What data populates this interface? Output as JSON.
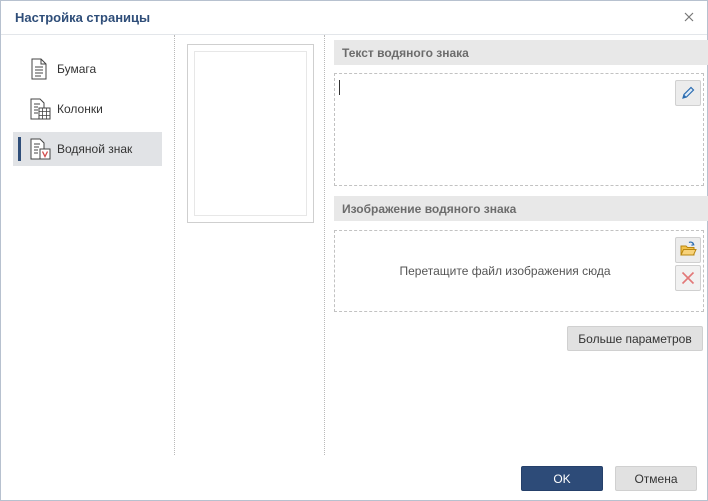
{
  "dialog": {
    "title": "Настройка страницы"
  },
  "nav": {
    "items": [
      {
        "label": "Бумага",
        "icon": "paper-icon",
        "active": false
      },
      {
        "label": "Колонки",
        "icon": "columns-icon",
        "active": false
      },
      {
        "label": "Водяной знак",
        "icon": "watermark-icon",
        "active": true
      }
    ]
  },
  "text_section": {
    "header": "Текст водяного знака",
    "value": ""
  },
  "image_section": {
    "header": "Изображение водяного знака",
    "drop_hint": "Перетащите файл изображения сюда"
  },
  "buttons": {
    "more_params": "Больше параметров",
    "ok": "OK",
    "cancel": "Отмена"
  },
  "colors": {
    "title": "#2f4e79",
    "primary": "#2d4b78",
    "accent_folder": "#e8a317",
    "delete_red": "#e27878"
  }
}
